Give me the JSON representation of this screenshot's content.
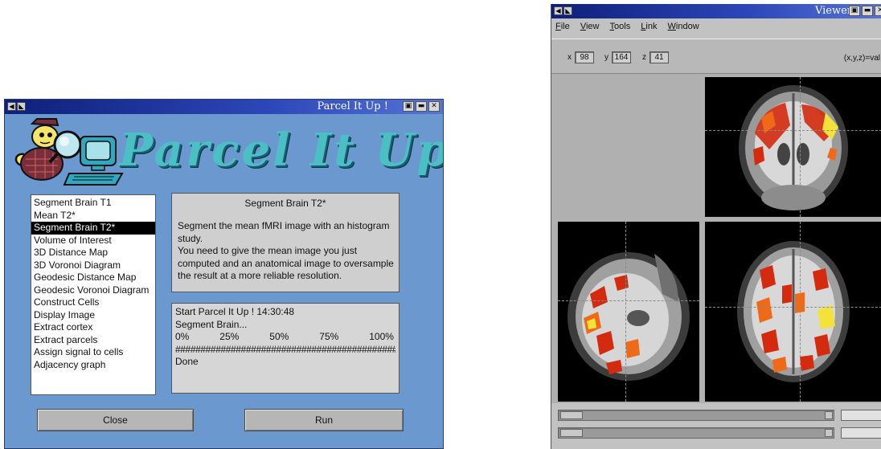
{
  "parcel_window": {
    "title": "Parcel It Up !",
    "banner": "Parcel It Up !",
    "steps": [
      "Segment Brain T1",
      "Mean T2*",
      "Segment Brain T2*",
      "Volume of Interest",
      "3D Distance Map",
      "3D Voronoi Diagram",
      "Geodesic Distance Map",
      "Geodesic Voronoi Diagram",
      "Construct Cells",
      "Display Image",
      "Extract cortex",
      "Extract parcels",
      "Assign signal to cells",
      "Adjacency graph"
    ],
    "selected_step": "Segment Brain T2*",
    "description": {
      "title": "Segment Brain T2*",
      "lines": [
        "Segment the mean fMRI image with an histogram",
        "study.",
        "You need to give the mean image you just",
        "computed and an anatomical image to oversample",
        "the result at a more reliable resolution."
      ]
    },
    "log": {
      "line1": "Start Parcel It Up ! 14:30:48",
      "line2": "Segment Brain...",
      "percents": [
        "0%",
        "25%",
        "50%",
        "75%",
        "100%"
      ],
      "progress": "############################################",
      "done": "Done"
    },
    "buttons": {
      "close": "Close",
      "run": "Run"
    },
    "colors": {
      "background": "#6b99cf",
      "banner": "#4bbfc4",
      "titlebar": "#1a2e8f"
    }
  },
  "viewer_window": {
    "title": "Viewer",
    "menu": [
      {
        "label": "File",
        "underline": "F",
        "rest": "ile"
      },
      {
        "label": "View",
        "underline": "V",
        "rest": "iew"
      },
      {
        "label": "Tools",
        "underline": "T",
        "rest": "ools"
      },
      {
        "label": "Link",
        "underline": "L",
        "rest": "ink"
      },
      {
        "label": "Window",
        "underline": "W",
        "rest": "indow"
      }
    ],
    "coords": {
      "x_label": "x",
      "x_value": "98",
      "y_label": "y",
      "y_value": "164",
      "z_label": "z",
      "z_value": "41",
      "readout": "(x,y,z)=val"
    },
    "views": [
      "coronal",
      "sagittal",
      "axial"
    ],
    "colors": {
      "activation_red": "#d42a10",
      "activation_orange": "#ee6a18",
      "activation_yellow": "#f2e23a"
    }
  }
}
